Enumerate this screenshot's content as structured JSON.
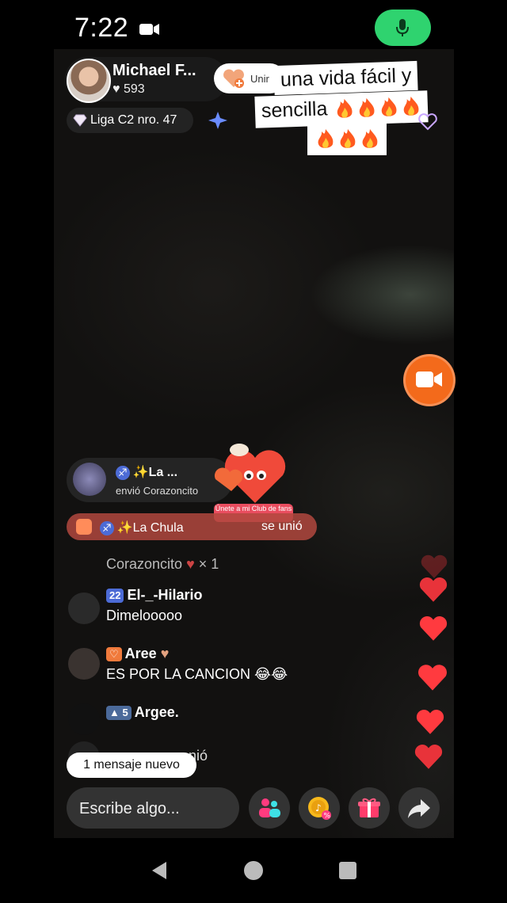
{
  "status_bar": {
    "time": "7:22"
  },
  "host": {
    "name": "Michael F...",
    "likes": "593",
    "join_label": "Unir"
  },
  "caption": {
    "line1": "una vida fácil y",
    "line2": "sencilla",
    "flames_line2": 4,
    "flames_line3": 3
  },
  "league": {
    "label": "Liga C2 nro. 47"
  },
  "gift": {
    "user": "✨La ...",
    "action": "envió Corazoncito",
    "club_badge": "Únete a mi Club de fans"
  },
  "joined": {
    "user": "✨La Chula",
    "action": "se unió"
  },
  "chat": {
    "faded": {
      "text": "Corazoncito",
      "count": "× 1"
    },
    "messages": [
      {
        "badge": "22",
        "user": "El-_-Hilario",
        "message": "Dimelooooo"
      },
      {
        "badge": "",
        "user": "Aree",
        "message": "ES POR LA CANCION 😂😂"
      },
      {
        "badge": "5",
        "user": "Argee.",
        "message": ""
      },
      {
        "badge": "",
        "user": "",
        "message": "nió"
      }
    ]
  },
  "new_messages_pill": "1 mensaje nuevo",
  "input": {
    "placeholder": "Escribe algo..."
  },
  "colors": {
    "mic_green": "#2fd36f",
    "call_orange": "#f36a1b",
    "heart_red": "#e8333a",
    "joined_bar": "#b2483e"
  },
  "icons": [
    "video-camera-icon",
    "microphone-icon",
    "diamond-icon",
    "sparkle-icon",
    "video-call-icon",
    "people-icon",
    "coin-discount-icon",
    "gift-icon",
    "share-arrow-icon",
    "nav-back-icon",
    "nav-home-icon",
    "nav-recent-icon"
  ]
}
